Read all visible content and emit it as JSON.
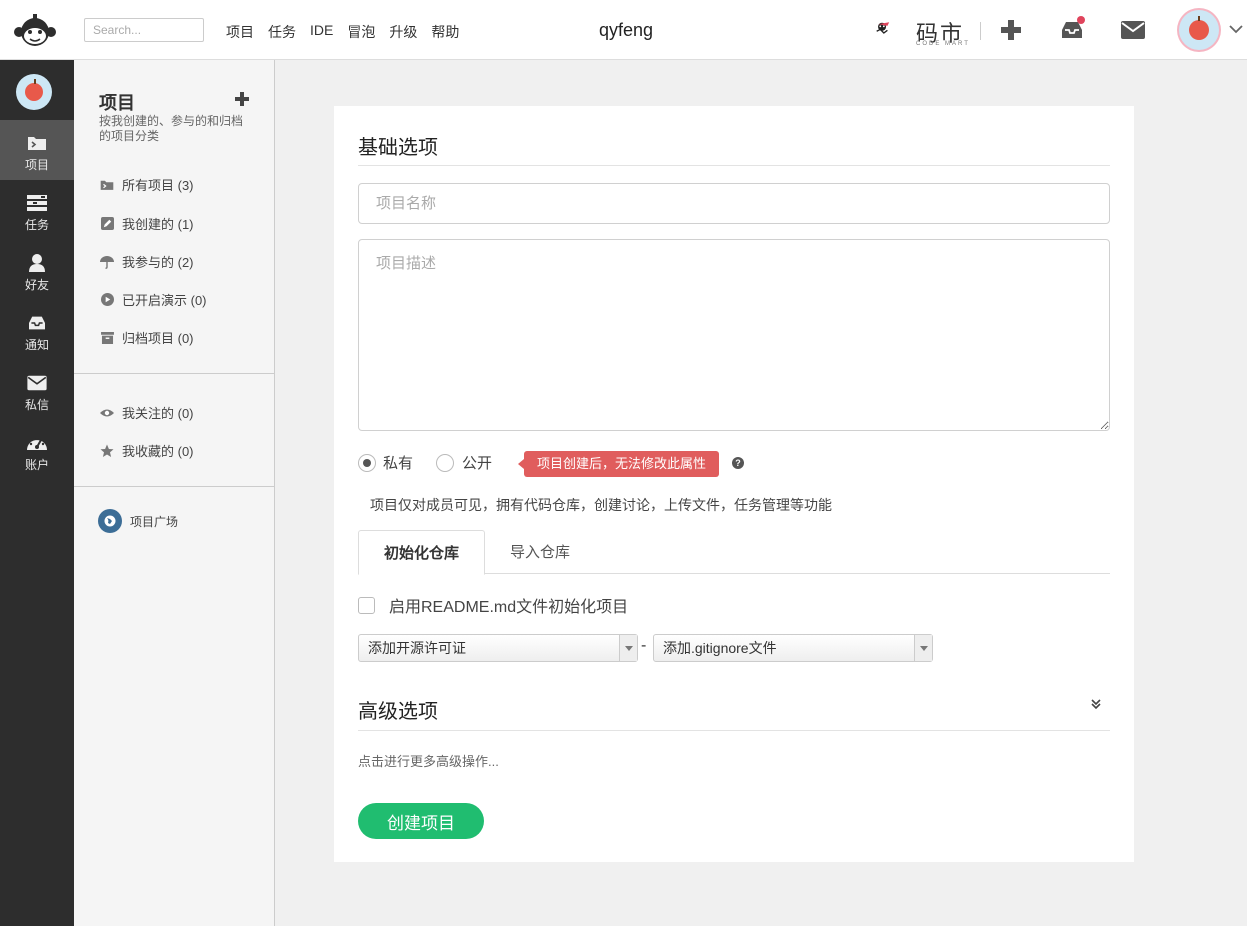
{
  "topbar": {
    "search_placeholder": "Search...",
    "nav": [
      "项目",
      "任务",
      "IDE",
      "冒泡",
      "升级",
      "帮助"
    ],
    "username": "qyfeng",
    "brand": "码市",
    "brand_sub": "CODE MART",
    "icons": [
      "plus-icon",
      "inbox-icon",
      "mail-icon",
      "chevron-down-icon"
    ],
    "notification_color": "#e0445c"
  },
  "leftbar": {
    "items": [
      {
        "label": "项目",
        "icon": "project-icon",
        "active": true
      },
      {
        "label": "任务",
        "icon": "tasks-icon"
      },
      {
        "label": "好友",
        "icon": "user-icon"
      },
      {
        "label": "通知",
        "icon": "inbox-icon"
      },
      {
        "label": "私信",
        "icon": "mail-icon"
      },
      {
        "label": "账户",
        "icon": "dashboard-icon"
      }
    ]
  },
  "sidebar": {
    "title": "项目",
    "desc": "按我创建的、参与的和归档的项目分类",
    "items": [
      {
        "label": "所有项目 (3)",
        "icon": "folder-icon"
      },
      {
        "label": "我创建的 (1)",
        "icon": "edit-icon"
      },
      {
        "label": "我参与的 (2)",
        "icon": "umbrella-icon"
      },
      {
        "label": "已开启演示 (0)",
        "icon": "play-icon"
      },
      {
        "label": "归档项目 (0)",
        "icon": "archive-icon"
      }
    ],
    "items2": [
      {
        "label": "我关注的 (0)",
        "icon": "eye-icon"
      },
      {
        "label": "我收藏的 (0)",
        "icon": "star-icon"
      }
    ],
    "plaza": "项目广场"
  },
  "form": {
    "basic_title": "基础选项",
    "name_placeholder": "项目名称",
    "desc_placeholder": "项目描述",
    "private_label": "私有",
    "public_label": "公开",
    "tip": "项目创建后，无法修改此属性",
    "visibility_desc": "项目仅对成员可见，拥有代码仓库，创建讨论，上传文件，任务管理等功能",
    "tab_init": "初始化仓库",
    "tab_import": "导入仓库",
    "readme_label": "启用README.md文件初始化项目",
    "license_select": "添加开源许可证",
    "separator": "-",
    "gitignore_select": "添加.gitignore文件",
    "advanced_title": "高级选项",
    "advanced_desc": "点击进行更多高级操作...",
    "create_button": "创建项目",
    "accent": "#20bd70",
    "tip_color": "#e05d5d"
  }
}
